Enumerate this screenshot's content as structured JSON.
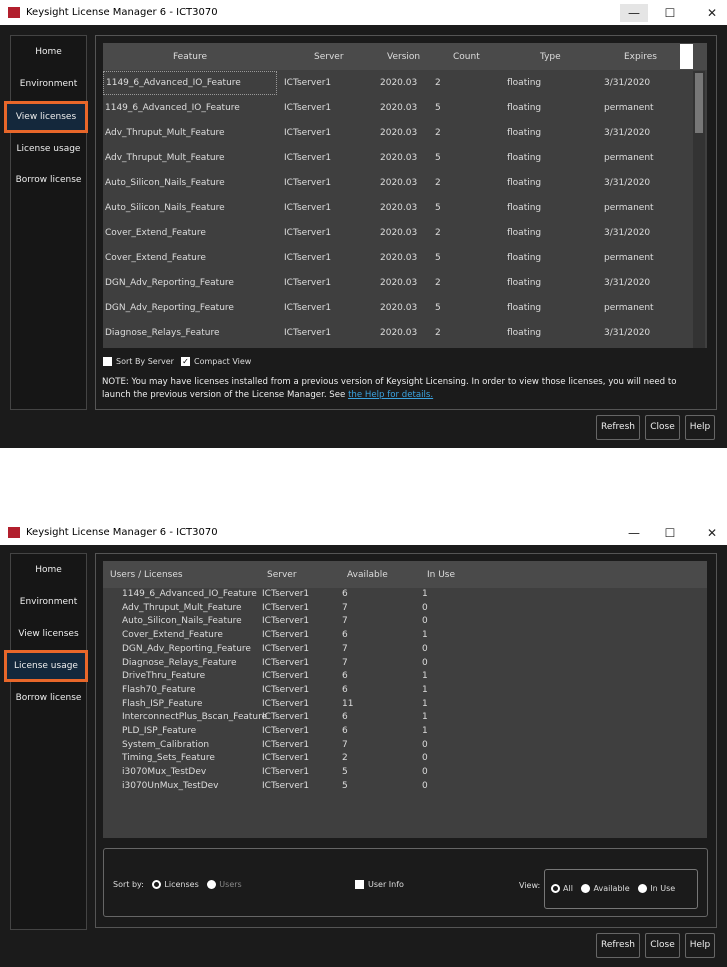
{
  "app_title": "Keysight License Manager 6 - ICT3070",
  "window_controls": {
    "minimize": "—",
    "maximize": "☐",
    "close": "✕"
  },
  "nav": [
    "Home",
    "Environment",
    "View licenses",
    "License usage",
    "Borrow license"
  ],
  "buttons": {
    "refresh": "Refresh",
    "close": "Close",
    "help": "Help"
  },
  "view_licenses": {
    "columns": [
      "Feature",
      "Server",
      "Version",
      "Count",
      "Type",
      "Expires"
    ],
    "rows": [
      [
        "1149_6_Advanced_IO_Feature",
        "ICTserver1",
        "2020.03",
        "2",
        "floating",
        "3/31/2020"
      ],
      [
        "1149_6_Advanced_IO_Feature",
        "ICTserver1",
        "2020.03",
        "5",
        "floating",
        "permanent"
      ],
      [
        "Adv_Thruput_Mult_Feature",
        "ICTserver1",
        "2020.03",
        "2",
        "floating",
        "3/31/2020"
      ],
      [
        "Adv_Thruput_Mult_Feature",
        "ICTserver1",
        "2020.03",
        "5",
        "floating",
        "permanent"
      ],
      [
        "Auto_Silicon_Nails_Feature",
        "ICTserver1",
        "2020.03",
        "2",
        "floating",
        "3/31/2020"
      ],
      [
        "Auto_Silicon_Nails_Feature",
        "ICTserver1",
        "2020.03",
        "5",
        "floating",
        "permanent"
      ],
      [
        "Cover_Extend_Feature",
        "ICTserver1",
        "2020.03",
        "2",
        "floating",
        "3/31/2020"
      ],
      [
        "Cover_Extend_Feature",
        "ICTserver1",
        "2020.03",
        "5",
        "floating",
        "permanent"
      ],
      [
        "DGN_Adv_Reporting_Feature",
        "ICTserver1",
        "2020.03",
        "2",
        "floating",
        "3/31/2020"
      ],
      [
        "DGN_Adv_Reporting_Feature",
        "ICTserver1",
        "2020.03",
        "5",
        "floating",
        "permanent"
      ],
      [
        "Diagnose_Relays_Feature",
        "ICTserver1",
        "2020.03",
        "2",
        "floating",
        "3/31/2020"
      ]
    ],
    "sort_by_server": "Sort By Server",
    "compact_view": "Compact View",
    "note": "NOTE: You may have licenses installed from a previous version of Keysight Licensing. In order to view those licenses, you will need to launch the previous version of the License Manager. See ",
    "help_link": "the Help for details."
  },
  "license_usage": {
    "columns": [
      "Users / Licenses",
      "Server",
      "Available",
      "In Use"
    ],
    "rows": [
      [
        "1149_6_Advanced_IO_Feature",
        "ICTserver1",
        "6",
        "1"
      ],
      [
        "Adv_Thruput_Mult_Feature",
        "ICTserver1",
        "7",
        "0"
      ],
      [
        "Auto_Silicon_Nails_Feature",
        "ICTserver1",
        "7",
        "0"
      ],
      [
        "Cover_Extend_Feature",
        "ICTserver1",
        "6",
        "1"
      ],
      [
        "DGN_Adv_Reporting_Feature",
        "ICTserver1",
        "7",
        "0"
      ],
      [
        "Diagnose_Relays_Feature",
        "ICTserver1",
        "7",
        "0"
      ],
      [
        "DriveThru_Feature",
        "ICTserver1",
        "6",
        "1"
      ],
      [
        "Flash70_Feature",
        "ICTserver1",
        "6",
        "1"
      ],
      [
        "Flash_ISP_Feature",
        "ICTserver1",
        "11",
        "1"
      ],
      [
        "InterconnectPlus_Bscan_Feature",
        "ICTserver1",
        "6",
        "1"
      ],
      [
        "PLD_ISP_Feature",
        "ICTserver1",
        "6",
        "1"
      ],
      [
        "System_Calibration",
        "ICTserver1",
        "7",
        "0"
      ],
      [
        "Timing_Sets_Feature",
        "ICTserver1",
        "2",
        "0"
      ],
      [
        "i3070Mux_TestDev",
        "ICTserver1",
        "5",
        "0"
      ],
      [
        "i3070UnMux_TestDev",
        "ICTserver1",
        "5",
        "0"
      ]
    ],
    "sort_by": "Sort by:",
    "sort_licenses": "Licenses",
    "sort_users": "Users",
    "user_info": "User Info",
    "view": "View:",
    "view_all": "All",
    "view_available": "Available",
    "view_in_use": "In Use"
  }
}
